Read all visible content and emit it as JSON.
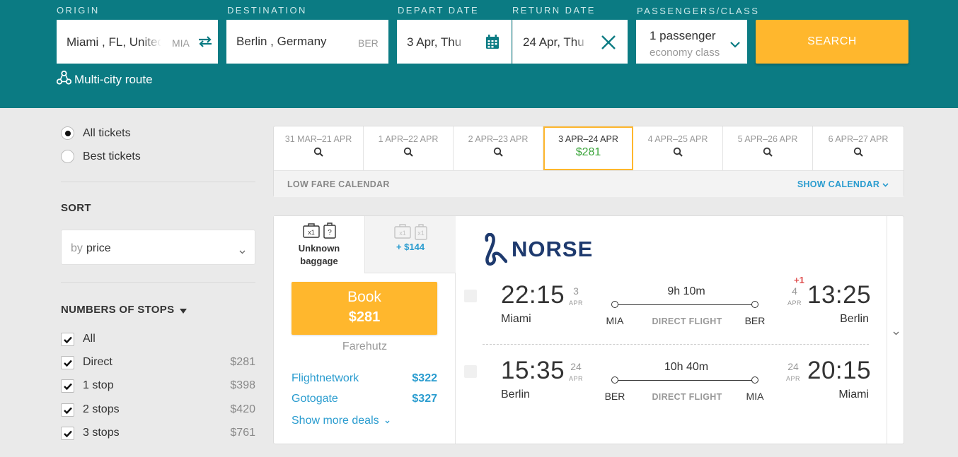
{
  "search": {
    "origin_label": "ORIGIN",
    "origin_value": "Miami , FL, United States",
    "origin_code": "MIA",
    "destination_label": "DESTINATION",
    "destination_value": "Berlin , Germany",
    "destination_code": "BER",
    "depart_label": "DEPART DATE",
    "depart_value": "3 Apr, Thu",
    "return_label": "RETURN DATE",
    "return_value": "24 Apr, Thu",
    "passengers_label": "PASSENGERS/CLASS",
    "passengers_value": "1 passenger",
    "class_value": "economy class",
    "search_button": "SEARCH",
    "multicity": "Multi-city route"
  },
  "filters": {
    "all_tickets": "All tickets",
    "best_tickets": "Best tickets",
    "sort_title": "SORT",
    "sort_by": "by",
    "sort_value": "price",
    "stops_title": "NUMBERS OF STOPS",
    "stops": [
      {
        "label": "All",
        "price": ""
      },
      {
        "label": "Direct",
        "price": "$281"
      },
      {
        "label": "1 stop",
        "price": "$398"
      },
      {
        "label": "2 stops",
        "price": "$420"
      },
      {
        "label": "3 stops",
        "price": "$761"
      }
    ]
  },
  "calendar": {
    "days": [
      {
        "label": "31 MAR–21 APR",
        "price": ""
      },
      {
        "label": "1 APR–22 APR",
        "price": ""
      },
      {
        "label": "2 APR–23 APR",
        "price": ""
      },
      {
        "label": "3 APR–24 APR",
        "price": "$281"
      },
      {
        "label": "4 APR–25 APR",
        "price": ""
      },
      {
        "label": "5 APR–26 APR",
        "price": ""
      },
      {
        "label": "6 APR–27 APR",
        "price": ""
      }
    ],
    "low_fare": "LOW FARE CALENDAR",
    "show_calendar": "SHOW CALENDAR"
  },
  "ticket": {
    "baggage_label_1": "Unknown",
    "baggage_label_2": "baggage",
    "baggage_upgrade": "+ $144",
    "baggage_x1": "x1",
    "baggage_q": "?",
    "book_label": "Book",
    "book_price": "$281",
    "agency": "Farehutz",
    "deals": [
      {
        "name": "Flightnetwork",
        "price": "$322"
      },
      {
        "name": "Gotogate",
        "price": "$327"
      }
    ],
    "show_more": "Show more deals",
    "airline": "NORSE",
    "outbound": {
      "dep_time": "22:15",
      "dep_day": "3",
      "dep_month": "APR",
      "dep_city": "Miami",
      "dep_code": "MIA",
      "duration": "9h 10m",
      "type": "DIRECT FLIGHT",
      "arr_time": "13:25",
      "arr_day": "4",
      "arr_month": "APR",
      "arr_city": "Berlin",
      "arr_code": "BER",
      "next_day": "+1"
    },
    "inbound": {
      "dep_time": "15:35",
      "dep_day": "24",
      "dep_month": "APR",
      "dep_city": "Berlin",
      "dep_code": "BER",
      "duration": "10h 40m",
      "type": "DIRECT FLIGHT",
      "arr_time": "20:15",
      "arr_day": "24",
      "arr_month": "APR",
      "arr_city": "Miami",
      "arr_code": "MIA"
    }
  },
  "colors": {
    "header": "#0b7b83",
    "accent": "#ffb72d",
    "link": "#2a9ccf",
    "price_green": "#3aa43a"
  }
}
